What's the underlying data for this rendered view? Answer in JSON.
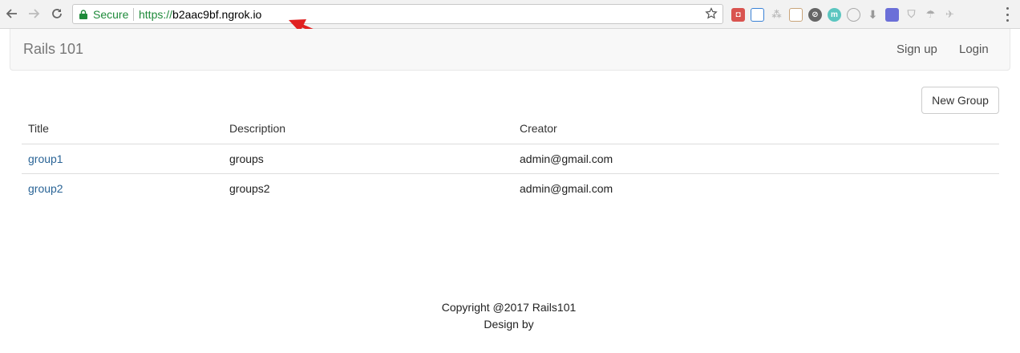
{
  "browser": {
    "secure_label": "Secure",
    "url_scheme": "https://",
    "url_host": "b2aac9bf.ngrok.io",
    "extensions": [
      "pocket-icon",
      "screenshot-icon",
      "tree-icon",
      "notes-icon",
      "compass-icon",
      "m-icon",
      "circle-icon",
      "download-icon",
      "page-icon",
      "shield-icon",
      "parachute-icon",
      "bird-icon"
    ]
  },
  "navbar": {
    "brand": "Rails 101",
    "signup": "Sign up",
    "login": "Login"
  },
  "main": {
    "new_group_label": "New Group",
    "table": {
      "headers": [
        "Title",
        "Description",
        "Creator"
      ],
      "rows": [
        {
          "title": "group1",
          "description": "groups",
          "creator": "admin@gmail.com"
        },
        {
          "title": "group2",
          "description": "groups2",
          "creator": "admin@gmail.com"
        }
      ]
    }
  },
  "footer": {
    "copyright": "Copyright @2017 Rails101",
    "design": "Design by"
  },
  "colors": {
    "secure_green": "#1e8a3a",
    "link_blue": "#2a6496",
    "arrow_red": "#e02020"
  }
}
